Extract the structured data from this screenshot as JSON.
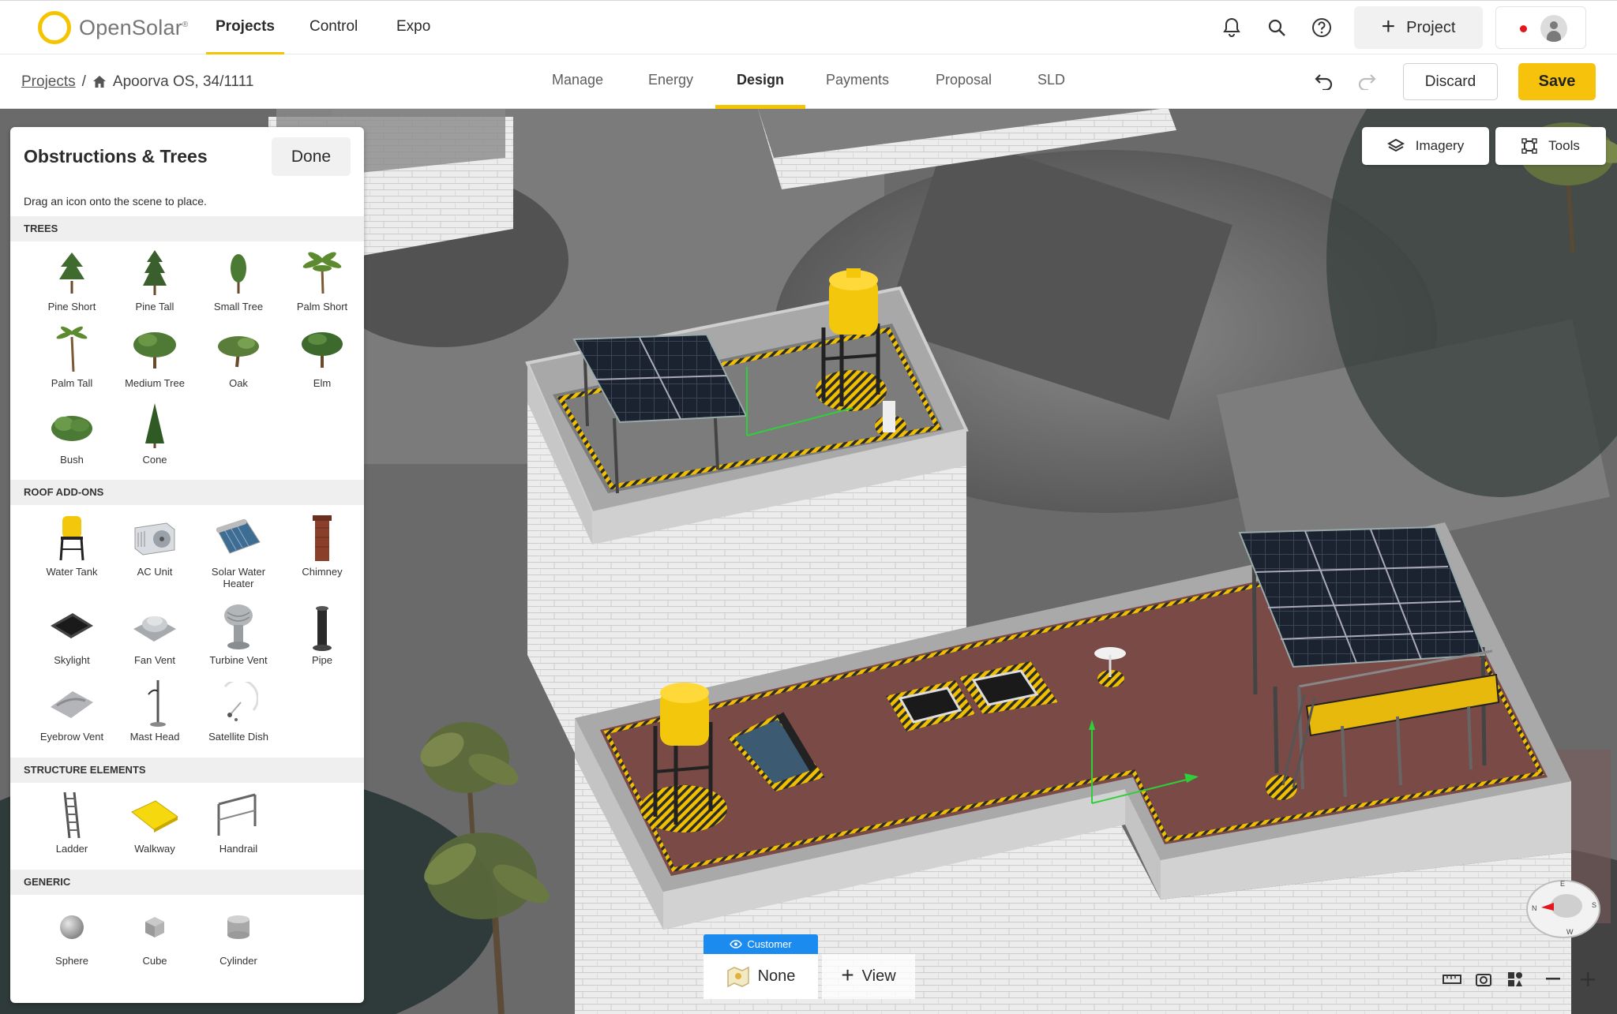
{
  "app": {
    "brand": "OpenSolar"
  },
  "topnav": {
    "tabs": [
      "Projects",
      "Control",
      "Expo"
    ],
    "active_tab": "Projects",
    "new_project_label": "Project"
  },
  "breadcrumb": {
    "root": "Projects",
    "separator": "/",
    "project": "Apoorva OS, 34/1111"
  },
  "subnav": {
    "tabs": [
      "Manage",
      "Energy",
      "Design",
      "Payments",
      "Proposal",
      "SLD"
    ],
    "active_tab": "Design",
    "discard_label": "Discard",
    "save_label": "Save"
  },
  "map_controls": {
    "imagery_label": "Imagery",
    "tools_label": "Tools"
  },
  "panel": {
    "title": "Obstructions & Trees",
    "done_label": "Done",
    "hint": "Drag an icon onto the scene to place.",
    "sections": [
      {
        "title": "TREES",
        "items": [
          "Pine Short",
          "Pine Tall",
          "Small Tree",
          "Palm Short",
          "Palm Tall",
          "Medium Tree",
          "Oak",
          "Elm",
          "Bush",
          "Cone"
        ]
      },
      {
        "title": "ROOF ADD-ONS",
        "items": [
          "Water Tank",
          "AC Unit",
          "Solar Water Heater",
          "Chimney",
          "Skylight",
          "Fan Vent",
          "Turbine Vent",
          "Pipe",
          "Eyebrow Vent",
          "Mast Head",
          "Satellite Dish"
        ]
      },
      {
        "title": "STRUCTURE ELEMENTS",
        "items": [
          "Ladder",
          "Walkway",
          "Handrail"
        ]
      },
      {
        "title": "GENERIC",
        "items": [
          "Sphere",
          "Cube",
          "Cylinder"
        ]
      }
    ]
  },
  "view_selector": {
    "badge": "Customer",
    "current_view": "None",
    "add_view_label": "View"
  },
  "compass": {
    "letters": [
      "N",
      "E",
      "S",
      "W"
    ]
  },
  "colors": {
    "accent": "#f5c400",
    "save_button": "#f7c20c",
    "badge_blue": "#1b8bf0",
    "roof_membrane": "#7a4a47",
    "brick_wall": "#eaeaea",
    "panel_cells": "#1c2330"
  }
}
